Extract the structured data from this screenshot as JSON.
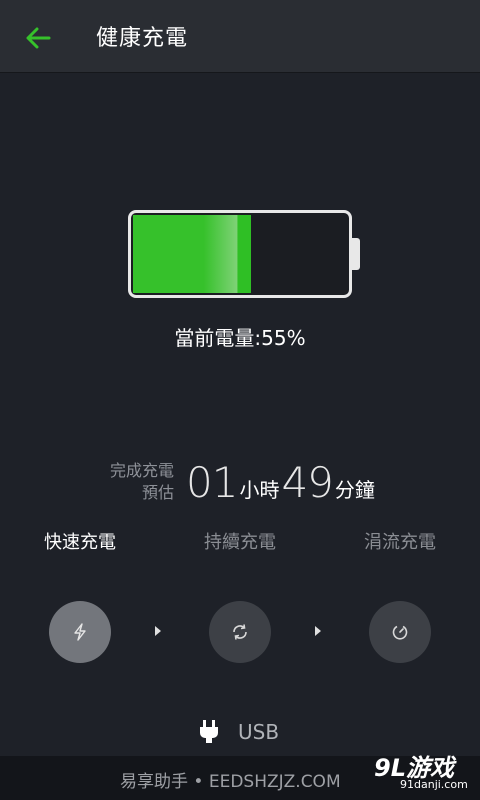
{
  "header": {
    "title": "健康充電"
  },
  "battery": {
    "level_text": "當前電量:55%",
    "level_fraction": 0.55
  },
  "estimate": {
    "label_line1": "完成充電",
    "label_line2": "預估",
    "hours": "01",
    "hours_unit": "小時",
    "minutes": "49",
    "minutes_unit": "分鐘"
  },
  "modes": [
    {
      "label": "快速充電",
      "icon": "lightning-icon",
      "active": true
    },
    {
      "label": "持續充電",
      "icon": "refresh-icon",
      "active": false
    },
    {
      "label": "涓流充電",
      "icon": "trickle-icon",
      "active": false
    }
  ],
  "source": {
    "label": "USB",
    "icon": "plug-icon"
  },
  "watermark": {
    "left_text": "易享助手 • EEDSHZJZ.COM",
    "logo_text": "9L游戏",
    "logo_sub": "91danji.com"
  },
  "colors": {
    "accent": "#36c12b",
    "background": "#1e2128",
    "header": "#2a2d33",
    "active_circle": "#73767c",
    "inactive_circle": "#3d4046"
  }
}
